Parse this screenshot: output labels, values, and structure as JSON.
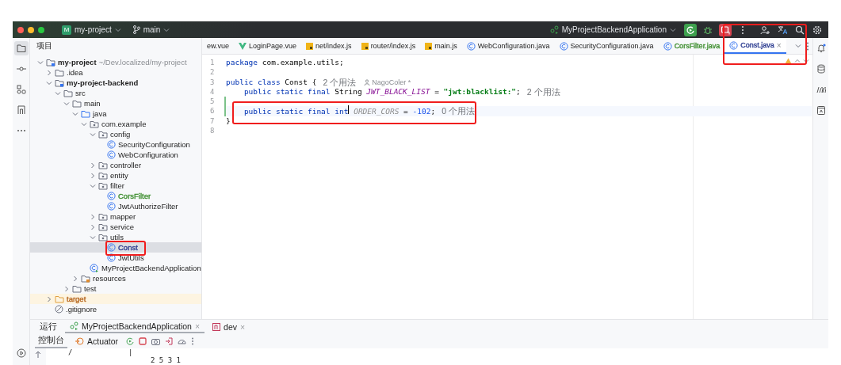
{
  "window": {
    "project_badge": "M",
    "project": "my-project",
    "branch": "main",
    "run_config": "MyProjectBackendApplication"
  },
  "project_panel": {
    "title": "项目",
    "tree": [
      {
        "label": "my-project",
        "kind": "module",
        "path": "~/Dev.localized/my-project",
        "expanded": true,
        "selected": false,
        "children": [
          {
            "label": ".idea",
            "kind": "folder",
            "expanded": false,
            "selected": false
          },
          {
            "label": "my-project-backend",
            "kind": "module",
            "expanded": true,
            "selected": false,
            "children": [
              {
                "label": "src",
                "kind": "folder",
                "expanded": true,
                "selected": false,
                "children": [
                  {
                    "label": "main",
                    "kind": "folder",
                    "expanded": true,
                    "selected": false,
                    "children": [
                      {
                        "label": "java",
                        "kind": "source",
                        "expanded": true,
                        "selected": false,
                        "children": [
                          {
                            "label": "com.example",
                            "kind": "package",
                            "expanded": true,
                            "selected": false,
                            "children": [
                              {
                                "label": "config",
                                "kind": "package",
                                "expanded": true,
                                "selected": false,
                                "children": [
                                  {
                                    "label": "SecurityConfiguration",
                                    "kind": "class",
                                    "selected": false
                                  },
                                  {
                                    "label": "WebConfiguration",
                                    "kind": "class",
                                    "selected": false
                                  }
                                ]
                              },
                              {
                                "label": "controller",
                                "kind": "package",
                                "expanded": false,
                                "selected": false
                              },
                              {
                                "label": "entity",
                                "kind": "package",
                                "expanded": false,
                                "selected": false
                              },
                              {
                                "label": "filter",
                                "kind": "package",
                                "expanded": true,
                                "selected": false,
                                "children": [
                                  {
                                    "label": "CorsFilter",
                                    "kind": "class",
                                    "color": "#3e8e2f",
                                    "selected": false
                                  },
                                  {
                                    "label": "JwtAuthorizeFilter",
                                    "kind": "class",
                                    "selected": false
                                  }
                                ]
                              },
                              {
                                "label": "mapper",
                                "kind": "package",
                                "expanded": false,
                                "selected": false
                              },
                              {
                                "label": "service",
                                "kind": "package",
                                "expanded": false,
                                "selected": false
                              },
                              {
                                "label": "utils",
                                "kind": "package",
                                "expanded": true,
                                "selected": false,
                                "children": [
                                  {
                                    "label": "Const",
                                    "kind": "class",
                                    "color": "#2a3a8f",
                                    "selected": true,
                                    "highlighted": true
                                  },
                                  {
                                    "label": "JwtUtils",
                                    "kind": "class",
                                    "selected": false
                                  }
                                ]
                              }
                            ]
                          },
                          {
                            "label": "MyProjectBackendApplication",
                            "kind": "app",
                            "selected": false
                          }
                        ]
                      },
                      {
                        "label": "resources",
                        "kind": "resources",
                        "expanded": false,
                        "selected": false
                      }
                    ]
                  },
                  {
                    "label": "test",
                    "kind": "folder",
                    "expanded": false,
                    "selected": false
                  }
                ]
              }
            ]
          },
          {
            "label": "target",
            "kind": "excluded",
            "color": "#b5651d",
            "expanded": false,
            "selected": false
          },
          {
            "label": ".gitignore",
            "kind": "ignore",
            "selected": false
          }
        ]
      }
    ]
  },
  "editor_tabs": [
    {
      "label": "ew.vue",
      "kind": "plain",
      "selected": false
    },
    {
      "label": "LoginPage.vue",
      "kind": "vue",
      "selected": false
    },
    {
      "label": "net/index.js",
      "kind": "js",
      "selected": false
    },
    {
      "label": "router/index.js",
      "kind": "js",
      "selected": false
    },
    {
      "label": "main.js",
      "kind": "js",
      "selected": false
    },
    {
      "label": "WebConfiguration.java",
      "kind": "java",
      "selected": false
    },
    {
      "label": "SecurityConfiguration.java",
      "kind": "java",
      "selected": false
    },
    {
      "label": "CorsFilter.java",
      "kind": "java",
      "color": "#3e8e2f",
      "selected": false
    },
    {
      "label": "Const.java",
      "kind": "java",
      "color": "#2a3a8f",
      "selected": true,
      "highlighted": true,
      "close": "×"
    }
  ],
  "editor": {
    "lines": [
      {
        "number": "1",
        "modified": false,
        "current": false,
        "tokens": [
          {
            "text": "package",
            "kind": "kw"
          },
          {
            "text": " com.example.utils;",
            "kind": "plain"
          }
        ]
      },
      {
        "number": "2",
        "modified": false,
        "current": false
      },
      {
        "number": "3",
        "modified": false,
        "current": false,
        "tokens": [
          {
            "text": "public class",
            "kind": "kw"
          },
          {
            "text": " Const {",
            "kind": "plain"
          },
          {
            "text": "2 个用法",
            "kind": "hint"
          },
          {
            "text": "NagoColer *",
            "kind": "author"
          }
        ]
      },
      {
        "number": "4",
        "modified": false,
        "current": false,
        "tokens": [
          {
            "text": "    public static final",
            "kind": "kw"
          },
          {
            "text": " String ",
            "kind": "plain"
          },
          {
            "text": "JWT_BLACK_LIST",
            "kind": "field"
          },
          {
            "text": " = ",
            "kind": "plain"
          },
          {
            "text": "\"jwt:blacklist:\"",
            "kind": "string"
          },
          {
            "text": ";",
            "kind": "plain"
          },
          {
            "text": "2 个用法",
            "kind": "hint"
          }
        ]
      },
      {
        "number": "5",
        "modified": true,
        "current": false
      },
      {
        "number": "6",
        "modified": true,
        "current": true,
        "highlighted": true,
        "tokens": [
          {
            "text": "    public static final int",
            "kind": "kw"
          },
          {
            "kind": "caret"
          },
          {
            "text": " ORDER_CORS",
            "kind": "unused"
          },
          {
            "text": " = ",
            "kind": "plain"
          },
          {
            "text": "-102",
            "kind": "number"
          },
          {
            "text": ";",
            "kind": "plain"
          },
          {
            "text": "0 个用法",
            "kind": "hint"
          }
        ]
      },
      {
        "number": "7",
        "modified": false,
        "current": false,
        "tokens": [
          {
            "text": "}",
            "kind": "plain"
          }
        ]
      },
      {
        "number": "8",
        "modified": false,
        "current": false
      }
    ]
  },
  "run_panel": {
    "tabs": [
      {
        "label": "运行",
        "kind": "title",
        "selected": false
      },
      {
        "label": "MyProjectBackendApplication",
        "kind": "run",
        "selected": true,
        "close": "×"
      },
      {
        "label": "dev",
        "kind": "npm",
        "selected": false,
        "close": "×"
      }
    ],
    "toolbar": [
      {
        "label": "控制台",
        "kind": "tab",
        "selected": true
      },
      {
        "label": "Actuator",
        "kind": "actuator",
        "selected": false
      }
    ],
    "console": [
      "/",
      "|",
      "2 5 3 1"
    ]
  }
}
